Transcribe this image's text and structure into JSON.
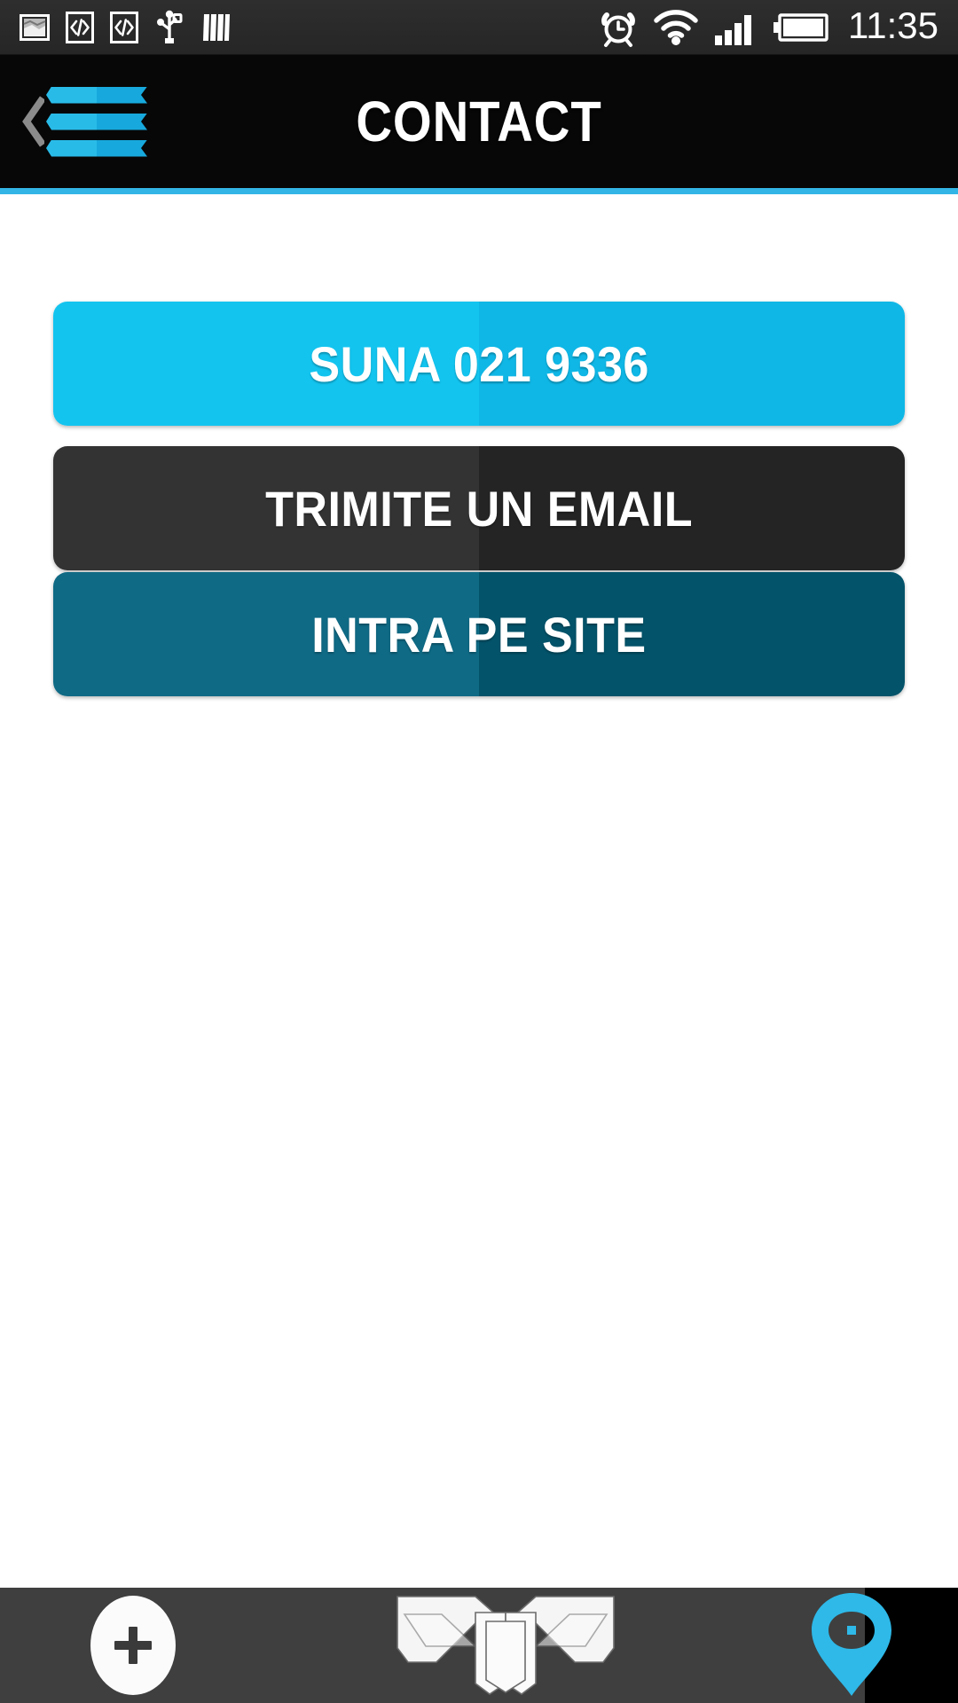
{
  "status_bar": {
    "time": "11:35",
    "left_icons": [
      {
        "name": "screenshot-icon"
      },
      {
        "name": "code-bracket-icon"
      },
      {
        "name": "code-bracket-icon-2"
      },
      {
        "name": "usb-icon"
      },
      {
        "name": "sim-card-icon"
      }
    ],
    "right_icons": [
      {
        "name": "alarm-clock-icon"
      },
      {
        "name": "wifi-icon"
      },
      {
        "name": "signal-bars-icon"
      },
      {
        "name": "battery-icon"
      }
    ]
  },
  "header": {
    "title": "CONTACT",
    "back_icon": "back-chevron-icon",
    "menu_icon": "hamburger-menu-icon",
    "accent_color": "#33b5e5",
    "background_color": "#070707"
  },
  "main": {
    "buttons": [
      {
        "id": "call",
        "label": "SUNA 021 9336",
        "color_left": "#13c4ef",
        "color_right": "#0fb7e6"
      },
      {
        "id": "email",
        "label": "TRIMITE UN EMAIL",
        "color_left": "#333333",
        "color_right": "#242424"
      },
      {
        "id": "site",
        "label": "INTRA PE SITE",
        "color_left": "#0f6a85",
        "color_right": "#03536a"
      }
    ]
  },
  "bottom_bar": {
    "background_color": "#3f3f3f",
    "items": [
      {
        "name": "add-button",
        "icon": "plus-icon"
      },
      {
        "name": "brand-logo",
        "icon": "winged-shield-logo-icon"
      },
      {
        "name": "location-button",
        "icon": "map-pin-icon",
        "color": "#2eb9e8"
      }
    ]
  }
}
